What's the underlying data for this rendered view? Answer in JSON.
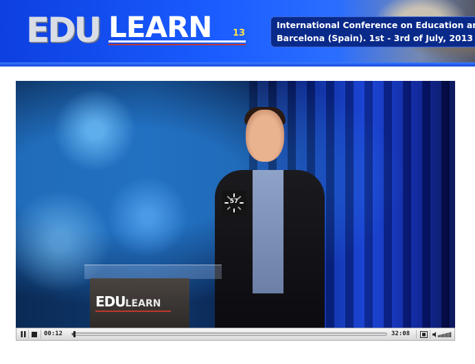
{
  "banner": {
    "logo": {
      "edu": "EDU",
      "learn": "LEARN",
      "num": "13"
    },
    "conference_line1": "International Conference on Education an",
    "conference_line2": "Barcelona (Spain).  1st - 3rd of July, 2013"
  },
  "video": {
    "loader_count": "57",
    "podium_logo": {
      "edu": "EDU",
      "learn": "LEARN"
    }
  },
  "controls": {
    "current_time": "00:12",
    "total_time": "32:08",
    "progress_fraction": 0.006
  },
  "colors": {
    "banner_blue": "#1a5cff",
    "accent_yellow": "#ffe24a",
    "accent_red": "#c0392b"
  },
  "icons": [
    "pause-icon",
    "stop-icon",
    "fullscreen-icon",
    "volume-icon",
    "loading-spinner-icon"
  ]
}
